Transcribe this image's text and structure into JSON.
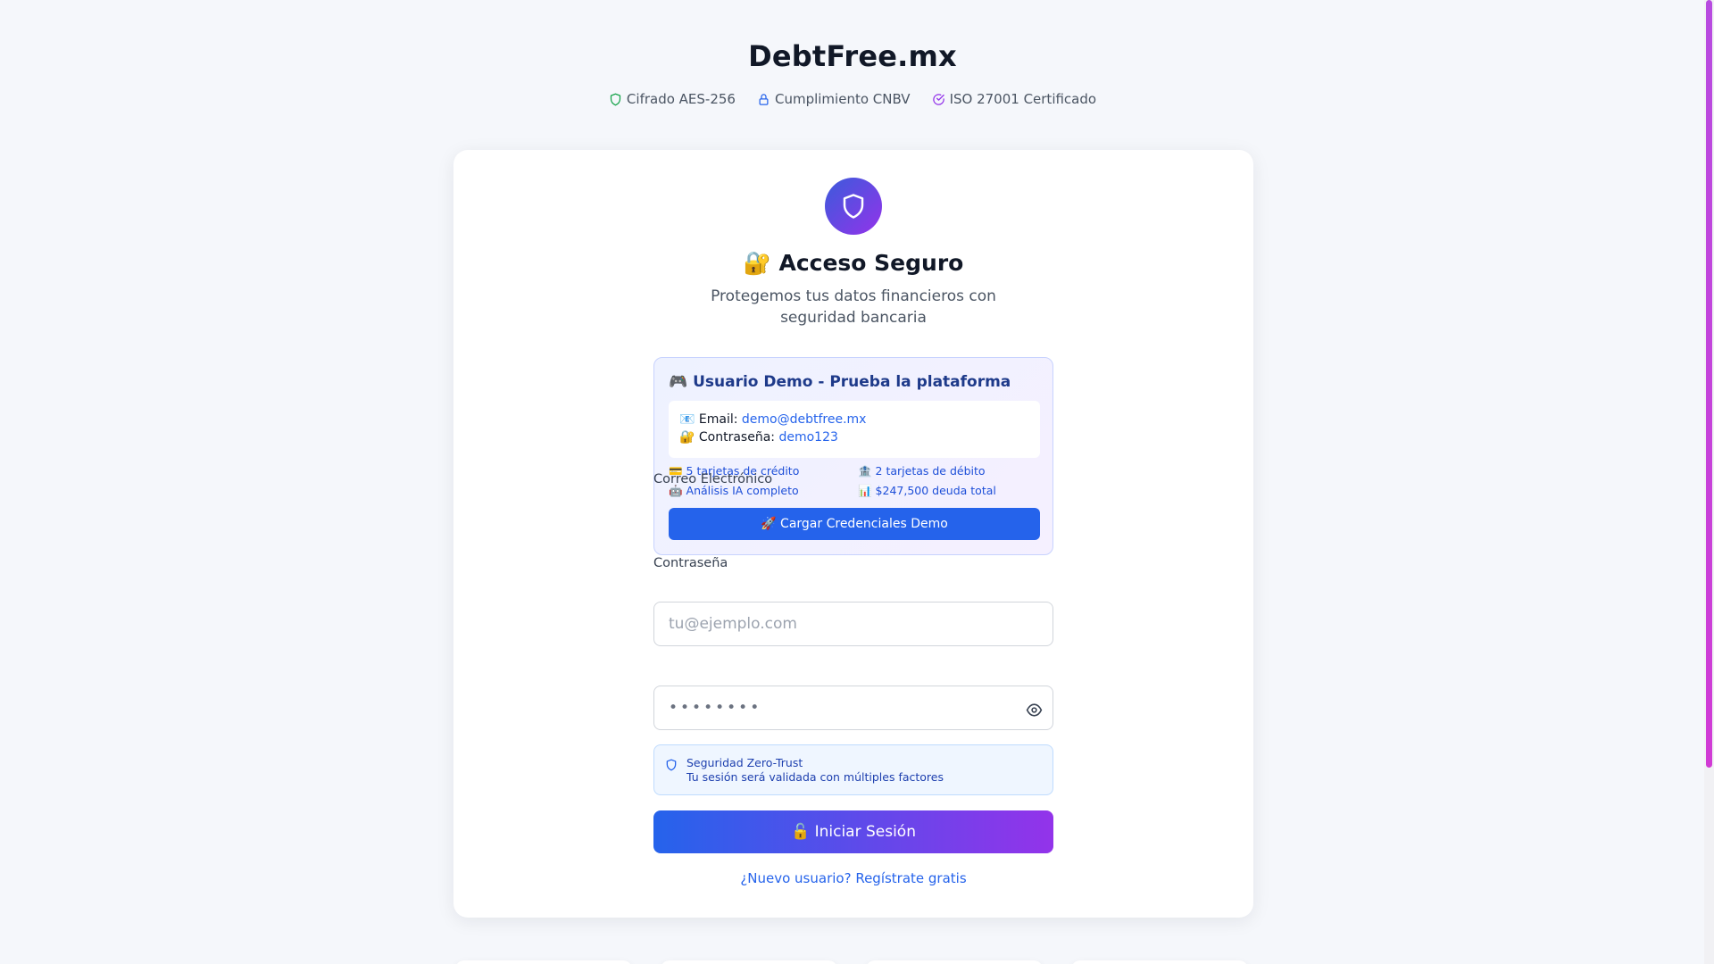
{
  "header": {
    "brand": "DebtFree.mx",
    "badges": [
      {
        "icon": "shield-icon",
        "label": "Cifrado AES-256",
        "color": "#16a34a"
      },
      {
        "icon": "lock-icon",
        "label": "Cumplimiento CNBV",
        "color": "#2563eb"
      },
      {
        "icon": "check-circle-icon",
        "label": "ISO 27001 Certificado",
        "color": "#9333ea"
      }
    ]
  },
  "card": {
    "logo_icon": "shield-icon",
    "title": "🔐 Acceso Seguro",
    "subtitle": "Protegemos tus datos financieros con seguridad bancaria"
  },
  "demo": {
    "title": "🎮 Usuario Demo - Prueba la plataforma",
    "email_label": "📧 Email: ",
    "email_value": "demo@debtfree.mx",
    "password_label": "🔐 Contraseña: ",
    "password_value": "demo123",
    "features": [
      "💳 5 tarjetas de crédito",
      "🏦 2 tarjetas de débito",
      "🤖 Análisis IA completo",
      "📊 $247,500 deuda total"
    ],
    "button_label": "🚀 Cargar Credenciales Demo"
  },
  "form": {
    "email_label": "Correo Electrónico",
    "email_placeholder": "tu@ejemplo.com",
    "password_label": "Contraseña",
    "password_placeholder": "••••••••",
    "toggle_icon": "eye-icon"
  },
  "security": {
    "icon": "shield-icon",
    "title": "Seguridad Zero-Trust",
    "description": "Tu sesión será validada con múltiples factores"
  },
  "actions": {
    "login_label": "🔓 Iniciar Sesión",
    "register_link": "¿Nuevo usuario? Regístrate gratis"
  },
  "colors": {
    "primary": "#2563eb",
    "accent": "#9333ea",
    "background": "#f5f7fb"
  }
}
